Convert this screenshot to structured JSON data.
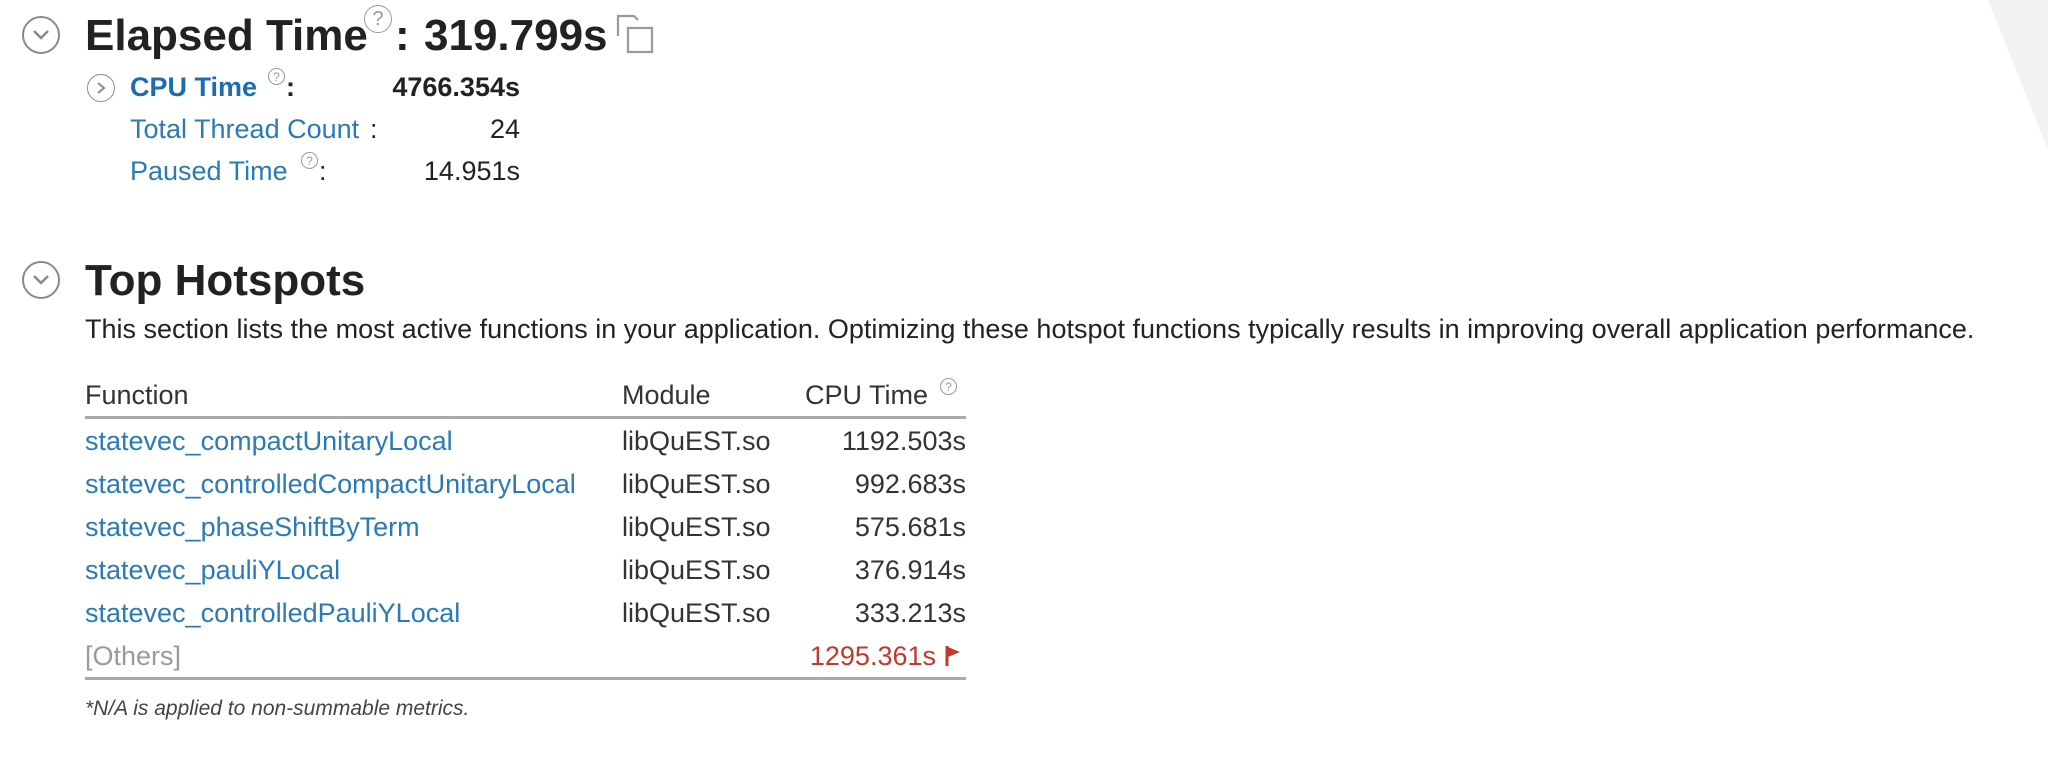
{
  "elapsed": {
    "title": "Elapsed Time",
    "colon": ":",
    "value": "319.799s",
    "help_glyph": "?",
    "copy_icon": "copy-icon"
  },
  "metrics": [
    {
      "label": "CPU Time",
      "colon": ":",
      "value": "4766.354s",
      "has_help": true
    },
    {
      "label": "Total Thread Count",
      "colon": ":",
      "value": "24",
      "has_help": false
    },
    {
      "label": "Paused Time",
      "colon": ":",
      "value": "14.951s",
      "has_help": true
    }
  ],
  "hotspots": {
    "title": "Top Hotspots",
    "description": "This section lists the most active functions in your application. Optimizing these hotspot functions typically results in improving overall application performance.",
    "columns": {
      "function": "Function",
      "module": "Module",
      "cpu_time": "CPU Time"
    },
    "rows": [
      {
        "function": "statevec_compactUnitaryLocal",
        "module": "libQuEST.so",
        "cpu_time": "1192.503s"
      },
      {
        "function": "statevec_controlledCompactUnitaryLocal",
        "module": "libQuEST.so",
        "cpu_time": "992.683s"
      },
      {
        "function": "statevec_phaseShiftByTerm",
        "module": "libQuEST.so",
        "cpu_time": "575.681s"
      },
      {
        "function": "statevec_pauliYLocal",
        "module": "libQuEST.so",
        "cpu_time": "376.914s"
      },
      {
        "function": "statevec_controlledPauliYLocal",
        "module": "libQuEST.so",
        "cpu_time": "333.213s"
      }
    ],
    "others": {
      "label": "[Others]",
      "cpu_time": "1295.361s",
      "flag_icon": "flag-icon"
    },
    "footnote": "*N/A is applied to non-summable metrics."
  },
  "colors": {
    "link": "#2a7ab8",
    "others_value": "#c0392b",
    "muted": "#9a9a9a"
  }
}
